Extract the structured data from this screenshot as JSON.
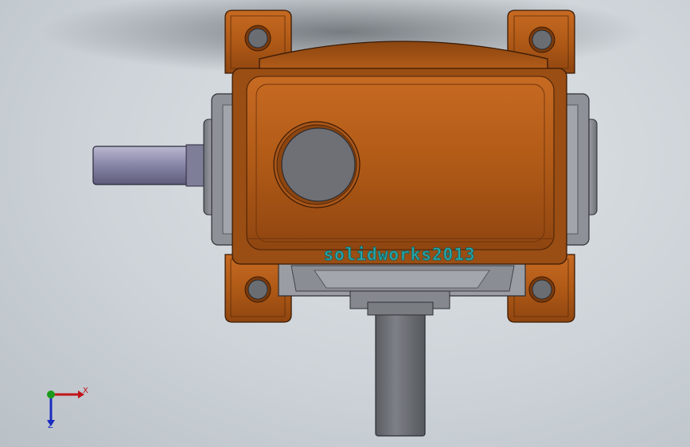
{
  "colors": {
    "background": "#cdd3d8",
    "housing_orange": "#b85f1a",
    "housing_dark": "#7a3a0c",
    "flange_gray": "#8a8d93",
    "shaft_purple": "#8a88a8",
    "shaft_gray": "#74777c",
    "inspection_cap": "#6b6e73",
    "watermark_teal": "#2aa7a8",
    "axis_x": "#c0141a",
    "axis_y": "#1a9a1a",
    "axis_z": "#1a2cc0"
  },
  "watermark": {
    "text": "solidworks2013"
  },
  "triad": {
    "x_label": "X",
    "z_label": "Z"
  },
  "icons": {
    "triad": "coordinate-triad-icon"
  }
}
